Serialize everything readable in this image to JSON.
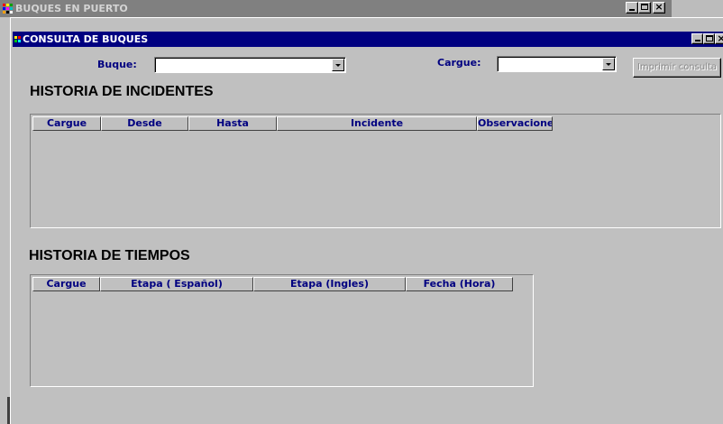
{
  "window": {
    "title": "BUQUES EN PUERTO",
    "controls": {
      "minimize": "_",
      "maximize": "□",
      "close": "×"
    }
  },
  "inner_window": {
    "title": "CONSULTA DE BUQUES"
  },
  "filters": {
    "buque_label": "Buque:",
    "buque_value": "",
    "cargue_label": "Cargue:",
    "cargue_value": ""
  },
  "print_button": {
    "label": "Imprimir consulta",
    "enabled": false
  },
  "incidentes": {
    "title": "HISTORIA DE INCIDENTES",
    "columns": [
      "Cargue",
      "Desde",
      "Hasta",
      "Incidente",
      "Observaciones"
    ],
    "rows": []
  },
  "tiempos": {
    "title": "HISTORIA DE TIEMPOS",
    "columns": [
      "Cargue",
      "Etapa ( Español)",
      "Etapa (Ingles)",
      "Fecha (Hora)"
    ],
    "rows": []
  },
  "colors": {
    "titlebar_active": "#000080",
    "titlebar_inactive": "#808080",
    "label": "#000080",
    "face": "#c0c0c0"
  }
}
